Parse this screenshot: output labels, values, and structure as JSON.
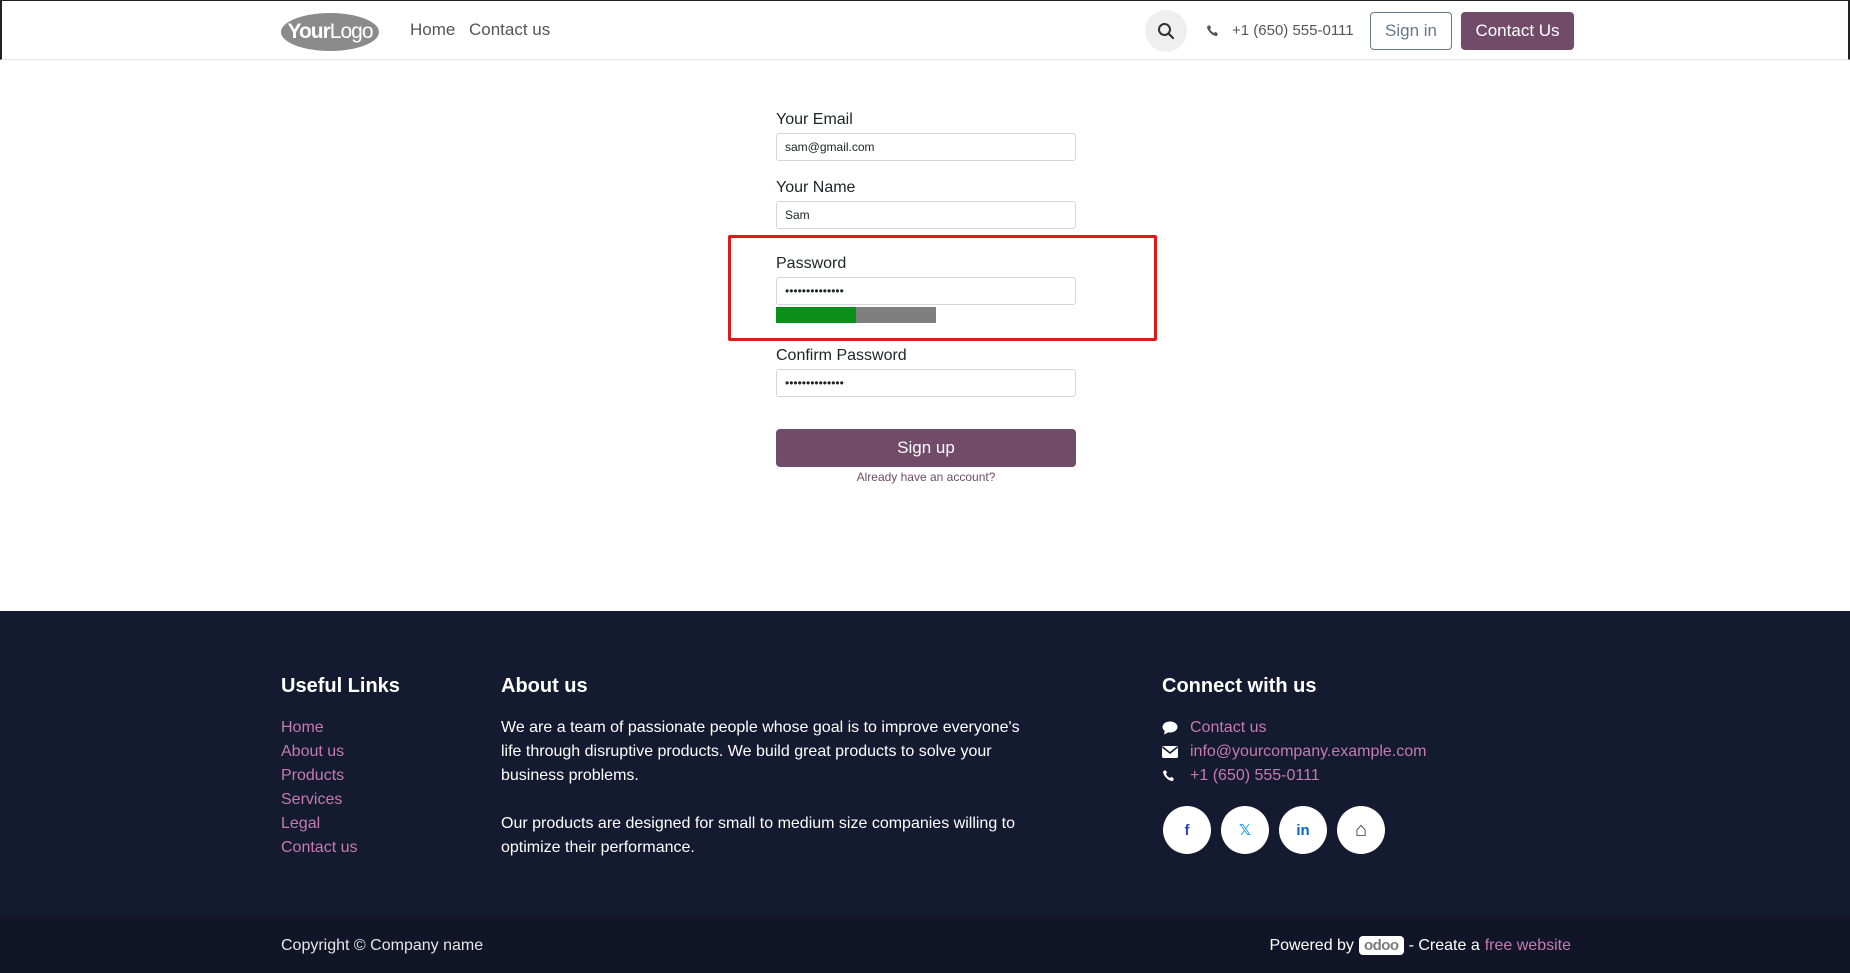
{
  "header": {
    "logo_text_bold": "Your",
    "logo_text_light": "Logo",
    "nav": [
      {
        "label": "Home"
      },
      {
        "label": "Contact us"
      }
    ],
    "phone": "+1 (650) 555-0111",
    "sign_in_label": "Sign in",
    "contact_label": "Contact Us"
  },
  "form": {
    "email_label": "Your Email",
    "email_value": "sam@gmail.com",
    "name_label": "Your Name",
    "name_value": "Sam",
    "password_label": "Password",
    "password_value": "••••••••••••••",
    "password_strength": 0.5,
    "confirm_label": "Confirm Password",
    "confirm_value": "••••••••••••••",
    "signup_label": "Sign up",
    "already_label": "Already have an account?"
  },
  "colors": {
    "accent": "#714b67",
    "link": "#c57bb2",
    "footer_bg": "#141a2f",
    "strength_good": "#0a8f1a",
    "highlight": "#e01919"
  },
  "footer": {
    "useful_links_title": "Useful Links",
    "useful_links": [
      "Home",
      "About us",
      "Products",
      "Services",
      "Legal",
      "Contact us"
    ],
    "about_title": "About us",
    "about_p1": "We are a team of passionate people whose goal is to improve everyone's life through disruptive products. We build great products to solve your business problems.",
    "about_p2": "Our products are designed for small to medium size companies willing to optimize their performance.",
    "connect_title": "Connect with us",
    "connect_items": [
      {
        "icon": "comment-icon",
        "label": "Contact us"
      },
      {
        "icon": "envelope-icon",
        "label": "info@yourcompany.example.com"
      },
      {
        "icon": "phone-icon",
        "label": "+1 (650) 555-0111"
      }
    ],
    "socials": [
      {
        "icon": "facebook-icon",
        "glyph": "f"
      },
      {
        "icon": "x-twitter-icon",
        "glyph": "𝕏"
      },
      {
        "icon": "linkedin-icon",
        "glyph": "in"
      },
      {
        "icon": "home-icon",
        "glyph": "⌂"
      }
    ]
  },
  "bottom": {
    "copyright": "Copyright © Company name",
    "powered_by": "Powered by",
    "odoo": "odoo",
    "create_a": "- Create a",
    "free_website": "free website"
  }
}
